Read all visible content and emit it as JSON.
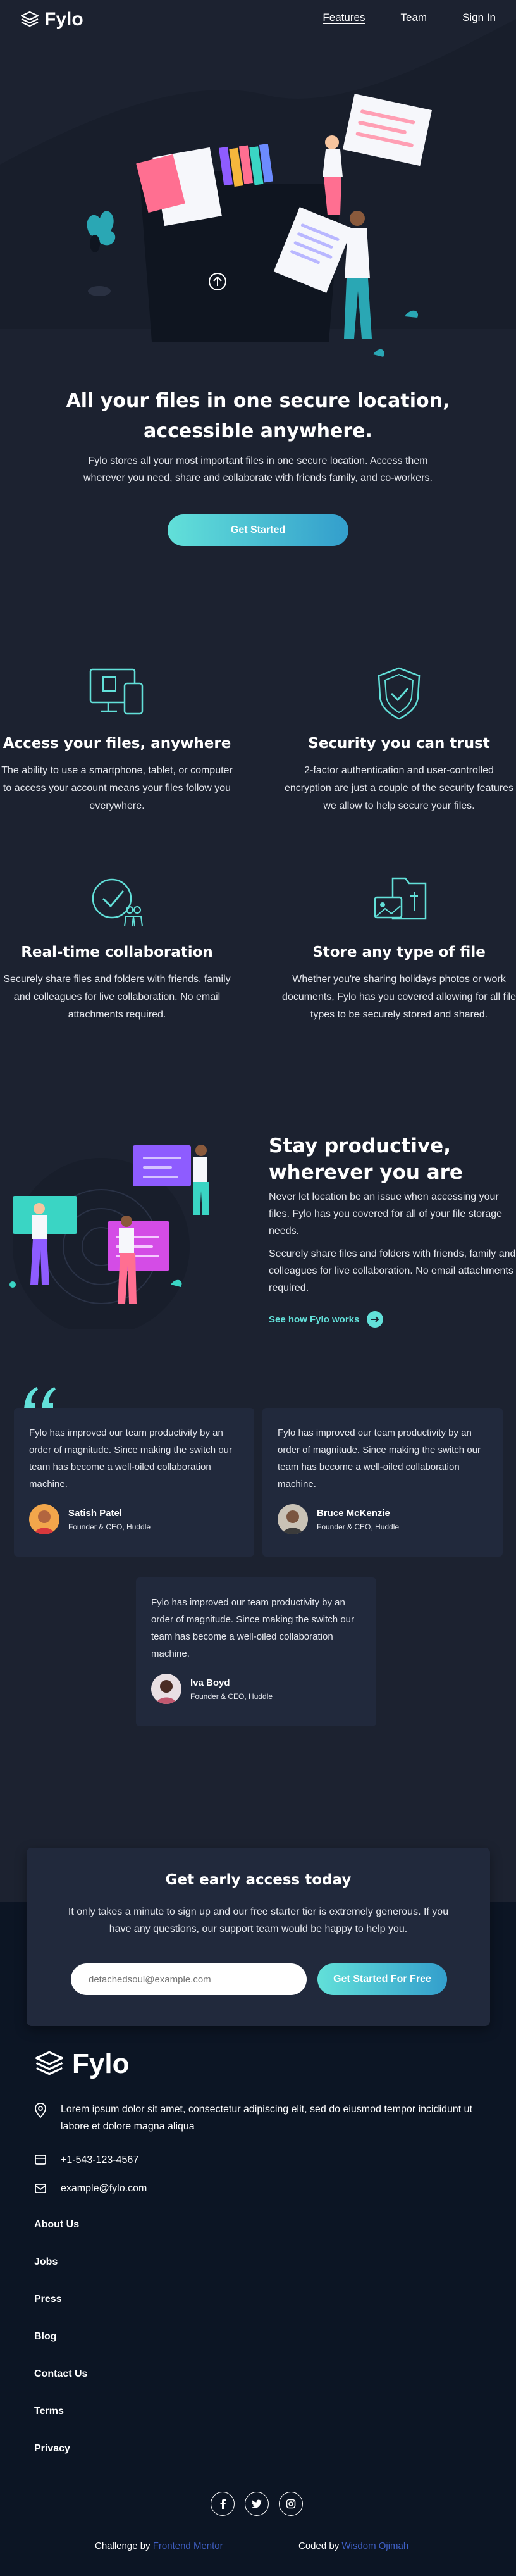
{
  "nav": {
    "logo": "Fylo",
    "links": [
      "Features",
      "Team",
      "Sign In"
    ]
  },
  "hero": {
    "title": "All your files in one secure location, accessible anywhere.",
    "text": "Fylo stores all your most important files in one secure location. Access them wherever you need, share and collaborate with friends family, and co-workers.",
    "cta": "Get Started"
  },
  "features": [
    {
      "title": "Access your files, anywhere",
      "text": "The ability to use a smartphone, tablet, or computer to access your account means your files follow you everywhere.",
      "icon": "devices-icon"
    },
    {
      "title": "Security you can trust",
      "text": "2-factor authentication and user-controlled encryption are just a couple of the security features we allow to help secure your files.",
      "icon": "shield-icon"
    },
    {
      "title": "Real-time collaboration",
      "text": "Securely share files and folders with friends, family and colleagues for live collaboration. No email attachments required.",
      "icon": "collaboration-icon"
    },
    {
      "title": "Store any type of file",
      "text": "Whether you're sharing holidays photos or work documents, Fylo has you covered allowing for all file types to be securely stored and shared.",
      "icon": "folder-icon"
    }
  ],
  "productive": {
    "title": "Stay productive, wherever you are",
    "p1": "Never let location be an issue when accessing your files. Fylo has you covered for all of your file storage needs.",
    "p2": "Securely share files and folders with friends, family and colleagues for live collaboration. No email attachments required.",
    "link": "See how Fylo works"
  },
  "testimonials": [
    {
      "text": "Fylo has improved our team productivity by an order of magnitude. Since making the switch our team has become a well-oiled collaboration machine.",
      "name": "Satish Patel",
      "role": "Founder & CEO, Huddle"
    },
    {
      "text": "Fylo has improved our team productivity by an order of magnitude. Since making the switch our team has become a well-oiled collaboration machine.",
      "name": "Bruce McKenzie",
      "role": "Founder & CEO, Huddle"
    },
    {
      "text": "Fylo has improved our team productivity by an order of magnitude. Since making the switch our team has become a well-oiled collaboration machine.",
      "name": "Iva Boyd",
      "role": "Founder & CEO, Huddle"
    }
  ],
  "early_access": {
    "title": "Get early access today",
    "text": "It only takes a minute to sign up and our free starter tier is extremely generous. If you have any questions, our support team would be happy to help you.",
    "input_placeholder": "detachedsoul@example.com",
    "button": "Get Started For Free"
  },
  "footer": {
    "logo": "Fylo",
    "address": "Lorem ipsum dolor sit amet, consectetur adipiscing elit, sed do eiusmod tempor incididunt ut labore et dolore magna aliqua",
    "phone": "+1-543-123-4567",
    "email": "example@fylo.com",
    "links": [
      "About Us",
      "Jobs",
      "Press",
      "Blog",
      "Contact Us",
      "Terms",
      "Privacy"
    ],
    "socials": [
      "facebook-icon",
      "twitter-icon",
      "instagram-icon"
    ],
    "credit_left_prefix": "Challenge by",
    "credit_left_link": "Frontend Mentor",
    "credit_right_prefix": "Coded by",
    "credit_right_link": "Wisdom Ojimah"
  },
  "colors": {
    "background": "#1c2230",
    "footer": "#0c1524",
    "card": "#21293c",
    "accent": "#62e0d9",
    "accent_dark": "#339ecc"
  }
}
